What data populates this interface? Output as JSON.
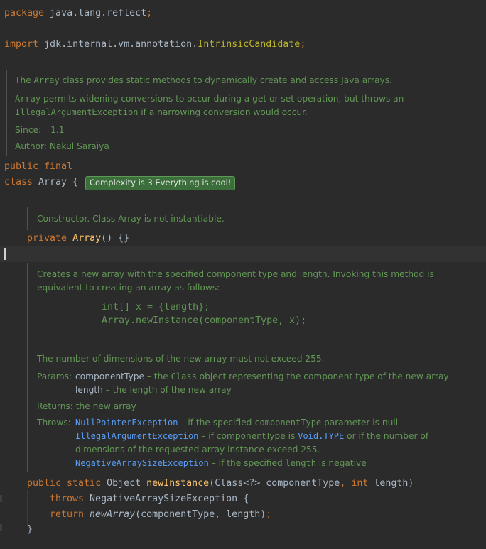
{
  "editor": {
    "line_package": "package java.lang.reflect;",
    "line_import_kw": "import",
    "line_import_path": " jdk.internal.vm.annotation.",
    "line_import_class": "IntrinsicCandidate",
    "line_import_semicolon": ";",
    "class_doc": {
      "l1a": "The ",
      "l1_mono": "Array",
      "l1b": " class provides static methods to dynamically create and access Java arrays.",
      "l2_mono": "Array",
      "l2b": " permits widening conversions to occur during a get or set operation, but throws an",
      "l3_mono": "IllegalArgumentException",
      "l3b": " if a narrowing conversion would occur.",
      "since_label": "Since:",
      "since_value": "1.1",
      "author_label": "Author:",
      "author_value": "Nakul Saraiya"
    },
    "public_final": "public final",
    "class_kw": "class",
    "class_name": " Array {",
    "badge": "Complexity is 3 Everything is cool!",
    "ctor_doc": "Constructor. Class Array is not instantiable.",
    "ctor_private": "private",
    "ctor_name": "Array",
    "ctor_rest": "() {}",
    "method_doc": {
      "p1": "Creates a new array with the specified component type and length. Invoking this method is",
      "p2": "equivalent to creating an array as follows:",
      "code1": "int[] x = {length};",
      "code2": "Array.newInstance(componentType, x);",
      "p3": "The number of dimensions of the new array must not exceed 255.",
      "params_label": "Params:",
      "param1_name": "componentType",
      "param1_a": " – the ",
      "param1_mono": "Class",
      "param1_b": " object representing the component type of the new array",
      "param2_name": "length",
      "param2_desc": " – the length of the new array",
      "returns_label": "Returns:",
      "returns_value": "the new array",
      "throws_label": "Throws:",
      "t1_link": "NullPointerException",
      "t1_a": " – if the specified ",
      "t1_mono": "componentType",
      "t1_b": " parameter is null",
      "t2_link": "IllegalArgumentException",
      "t2_a": " – if componentType is ",
      "t2_link2": "Void.TYPE",
      "t2_b": " or if the number of",
      "t2_c": "dimensions of the requested array instance exceed 255.",
      "t3_link": "NegativeArraySizeException",
      "t3_a": " – if the specified ",
      "t3_mono": "length",
      "t3_b": " is negative"
    },
    "sig_public": "public static ",
    "sig_obj": "Object ",
    "sig_name": "newInstance",
    "sig_p1": "(Class<?> componentType",
    "sig_comma": ", ",
    "sig_int": "int",
    "sig_p2": " length)",
    "throws_kw": "throws",
    "throws_rest": " NegativeArraySizeException {",
    "return_kw": "return ",
    "return_call": "newArray",
    "return_args": "(componentType, length)",
    "return_semi": ";",
    "close_brace": "}"
  }
}
